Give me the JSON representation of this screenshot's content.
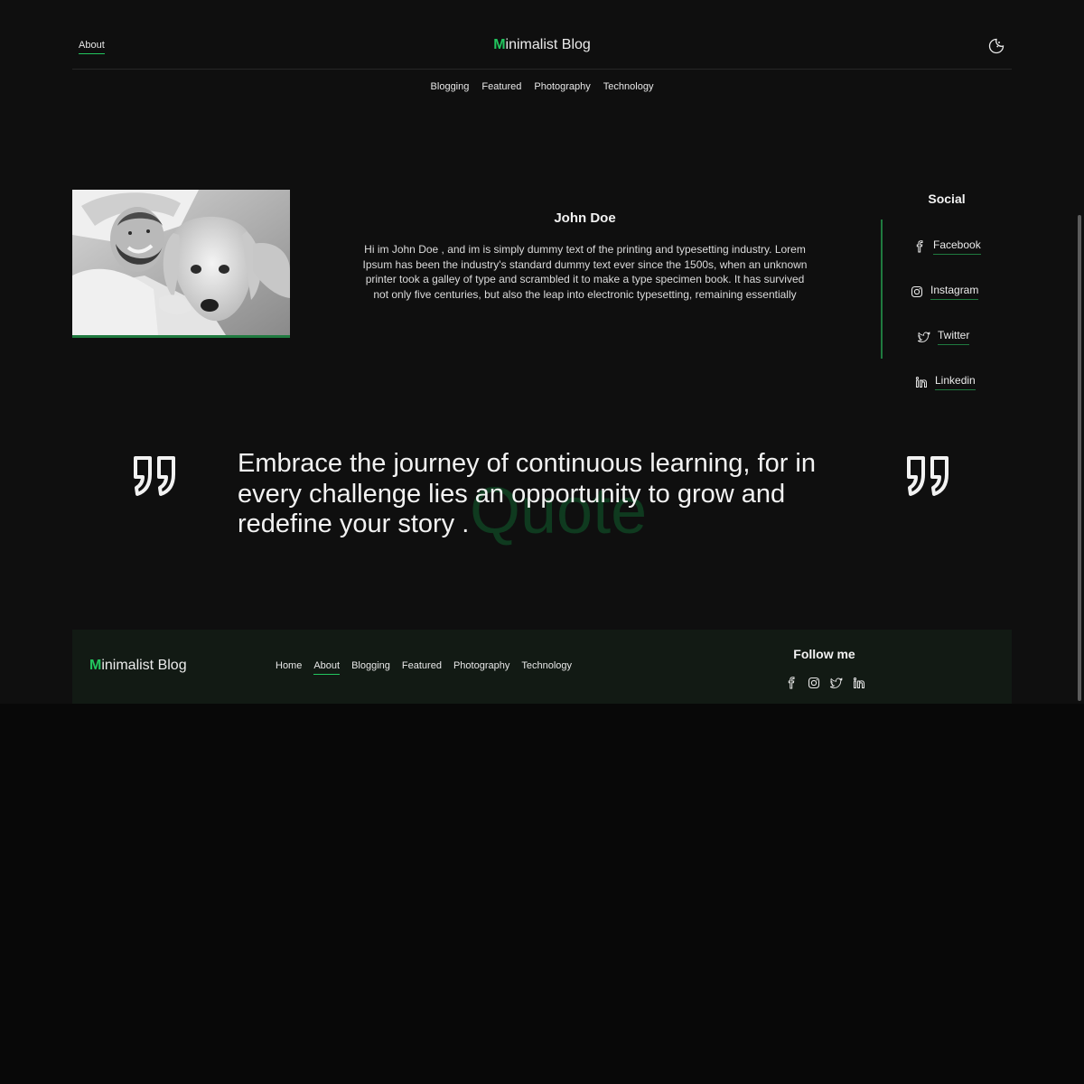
{
  "header": {
    "about_link": "About",
    "logo_initial": "M",
    "logo_rest": "inimalist Blog",
    "theme_toggle_icon": "moon-sun-icon"
  },
  "subnav": {
    "items": [
      "Blogging",
      "Featured",
      "Photography",
      "Technology"
    ]
  },
  "profile": {
    "photo_description_icon": "profile-photo",
    "name": "John Doe",
    "bio": "Hi im John Doe , and im is simply dummy text of the printing and typesetting industry. Lorem Ipsum has been the industry's standard dummy text ever since the 1500s, when an unknown printer took a galley of type and scrambled it to make a type specimen book. It has survived not only five centuries, but also the leap into electronic typesetting, remaining essentially"
  },
  "social": {
    "heading": "Social",
    "items": [
      {
        "label": "Facebook",
        "icon": "facebook-icon"
      },
      {
        "label": "Instagram",
        "icon": "instagram-icon"
      },
      {
        "label": "Twitter",
        "icon": "twitter-icon"
      },
      {
        "label": "Linkedin",
        "icon": "linkedin-icon"
      }
    ]
  },
  "quote": {
    "text": "Embrace the journey of continuous learning, for in every challenge lies an opportunity to grow and redefine your story .",
    "watermark": "Quote"
  },
  "footer": {
    "logo_initial": "M",
    "logo_rest": "inimalist Blog",
    "nav": [
      "Home",
      "About",
      "Blogging",
      "Featured",
      "Photography",
      "Technology"
    ],
    "active_nav": "About",
    "follow_heading": "Follow me",
    "icons": [
      "facebook-icon",
      "instagram-icon",
      "twitter-icon",
      "linkedin-icon"
    ]
  },
  "colors": {
    "accent": "#22c55e",
    "accent_dark": "#1f7a3f",
    "background": "#0f0f0f",
    "footer_background": "#121a14"
  }
}
